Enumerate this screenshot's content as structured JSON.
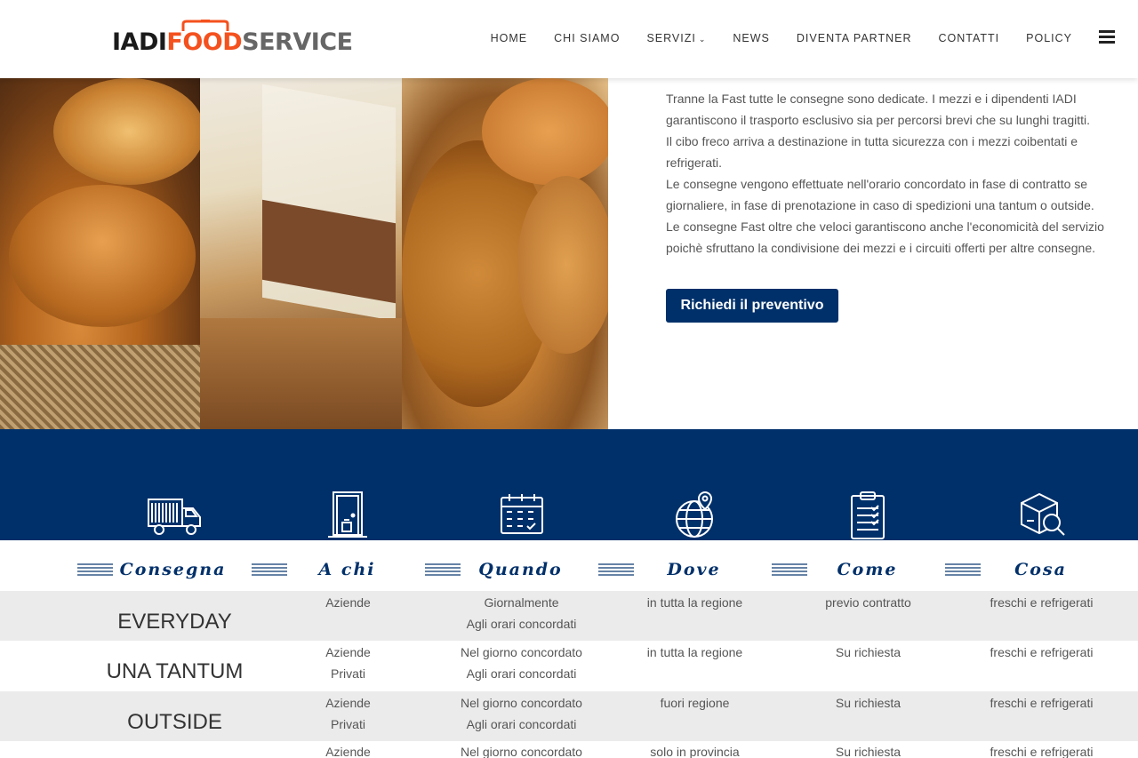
{
  "header": {
    "logo": {
      "part1": "IADI",
      "part2": "FOOD",
      "part3": "SERVICE"
    },
    "nav": [
      {
        "label": "HOME"
      },
      {
        "label": "CHI SIAMO"
      },
      {
        "label": "SERVIZI"
      },
      {
        "label": "NEWS"
      },
      {
        "label": "DIVENTA PARTNER"
      },
      {
        "label": "CONTATTI"
      },
      {
        "label": "POLICY"
      }
    ],
    "menu_icon": "hamburger-icon"
  },
  "content": {
    "paragraphs": [
      "Tranne la Fast tutte le consegne sono dedicate. I mezzi e i dipendenti IADI garantiscono il trasporto esclusivo sia per percorsi brevi che su lunghi tragitti.",
      "Il cibo freco arriva a destinazione in tutta sicurezza con i mezzi coibentati e refrigerati.",
      "Le consegne vengono effettuate nell'orario concordato in fase di contratto se giornaliere, in fase di prenotazione in caso di spedizioni una tantum o outside.",
      "Le consegne Fast oltre che veloci garantiscono anche l'economicità del servizio poichè sfruttano la condivisione dei mezzi e i circuiti offerti per altre consegne."
    ],
    "cta": "Richiedi il preventivo"
  },
  "icons": [
    "truck-icon",
    "door-icon",
    "calendar-icon",
    "globe-pin-icon",
    "clipboard-icon",
    "box-search-icon"
  ],
  "table": {
    "headers": [
      "Consegna",
      "A chi",
      "Quando",
      "Dove",
      "Come",
      "Cosa"
    ],
    "rows": [
      {
        "name": "EVERYDAY",
        "achi": [
          "Aziende"
        ],
        "quando": [
          "Giornalmente",
          "Agli orari concordati"
        ],
        "dove": "in tutta la regione",
        "come": "previo contratto",
        "cosa": "freschi e refrigerati"
      },
      {
        "name": "UNA TANTUM",
        "achi": [
          "Aziende",
          "Privati"
        ],
        "quando": [
          "Nel giorno concordato",
          "Agli orari concordati"
        ],
        "dove": "in tutta la regione",
        "come": "Su richiesta",
        "cosa": "freschi e refrigerati"
      },
      {
        "name": "OUTSIDE",
        "achi": [
          "Aziende",
          "Privati"
        ],
        "quando": [
          "Nel giorno concordato",
          "Agli orari concordati"
        ],
        "dove": "fuori regione",
        "come": "Su richiesta",
        "cosa": "freschi e refrigerati"
      },
      {
        "name": "",
        "achi": [
          "Aziende"
        ],
        "quando": [
          "Nel giorno concordato"
        ],
        "dove": "solo in provincia",
        "come": "Su richiesta",
        "cosa": "freschi e refrigerati"
      }
    ]
  }
}
